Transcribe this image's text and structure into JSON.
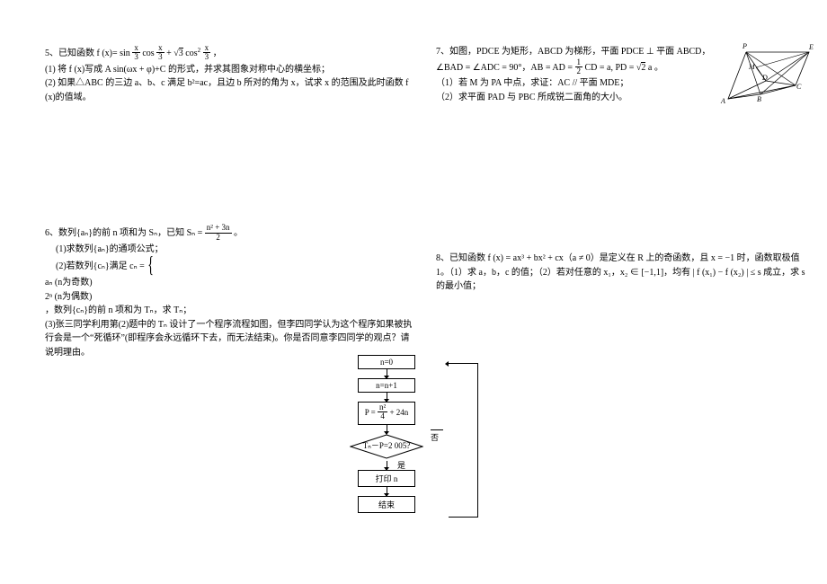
{
  "q5": {
    "lead": "5、已知函数 f (x)= sin",
    "cosx": " cos",
    "plus": " + ",
    "sqrt3": "3",
    "cos2": " cos",
    "period": "，",
    "part1": "(1) 将 f (x)写成 A sin(ωx + φ)+C 的形式，并求其图象对称中心的横坐标；",
    "part2": "(2) 如果△ABC 的三边 a、b、c 满足 b²=ac，且边 b 所对的角为 x，试求 x 的范围及此时函数 f (x)的值域。",
    "frac_x_3": {
      "nu": "x",
      "de": "3"
    }
  },
  "q6": {
    "lead": "6、数列{aₙ}的前 n 项和为 Sₙ，已知 Sₙ = ",
    "frac": {
      "nu": "n² + 3n",
      "de": "2"
    },
    "tail": " 。",
    "p1": "(1)求数列{aₙ}的通项公式；",
    "p2a": "(2)若数列{cₙ}满足 cₙ = ",
    "p2_case1": "aₙ   (n为奇数)",
    "p2_case2": "2ⁿ   (n为偶数)",
    "p2b": "，数列{cₙ}的前 n 项和为 Tₙ，求 Tₙ；",
    "p3": "(3)张三同学利用第(2)题中的 Tₙ 设计了一个程序流程如图，但李四同学认为这个程序如果被执行会是一个“死循环”(即程序会永远循环下去，而无法结束)。你是否同意李四同学的观点？请说明理由。"
  },
  "flow": {
    "b1": "n=0",
    "b2": "n=n+1",
    "b3a": "P = ",
    "b3frac": {
      "nu": "n²",
      "de": "4"
    },
    "b3b": " + 24n",
    "cond": "Tₙ－P=2 005?",
    "yes": "是",
    "no": "否",
    "print": "打印 n",
    "end": "结束"
  },
  "q7": {
    "line1": "7、如图，PDCE 为矩形，ABCD 为梯形，平面 PDCE ⊥ 平面 ABCD，",
    "line2a": "∠BAD = ∠ADC = 90°，AB = AD = ",
    "half": {
      "nu": "1",
      "de": "2"
    },
    "line2b": " CD = a, PD = ",
    "sqrt2": "2",
    "line2c": "a 。",
    "p1": "（1）若 M 为 PA 中点，求证：AC // 平面 MDE；",
    "p2": "（2）求平面 PAD 与 PBC 所成锐二面角的大小。"
  },
  "q8": {
    "line1": "8、已知函数 f (x) = ax³ + bx² + cx（a ≠ 0）是定义在 R 上的奇函数，且 x = −1 时，函数取极值 1。（1）求 a，b，c 的值；（2）若对任意的 x₁，x₂ ∈ [−1,1]，均有 | f (x₁) − f (x₂) | ≤ s 成立，求 s 的最小值；"
  },
  "geo": {
    "P": "P",
    "E": "E",
    "A": "A",
    "B": "B",
    "C": "C",
    "D": "D",
    "M": "M"
  }
}
